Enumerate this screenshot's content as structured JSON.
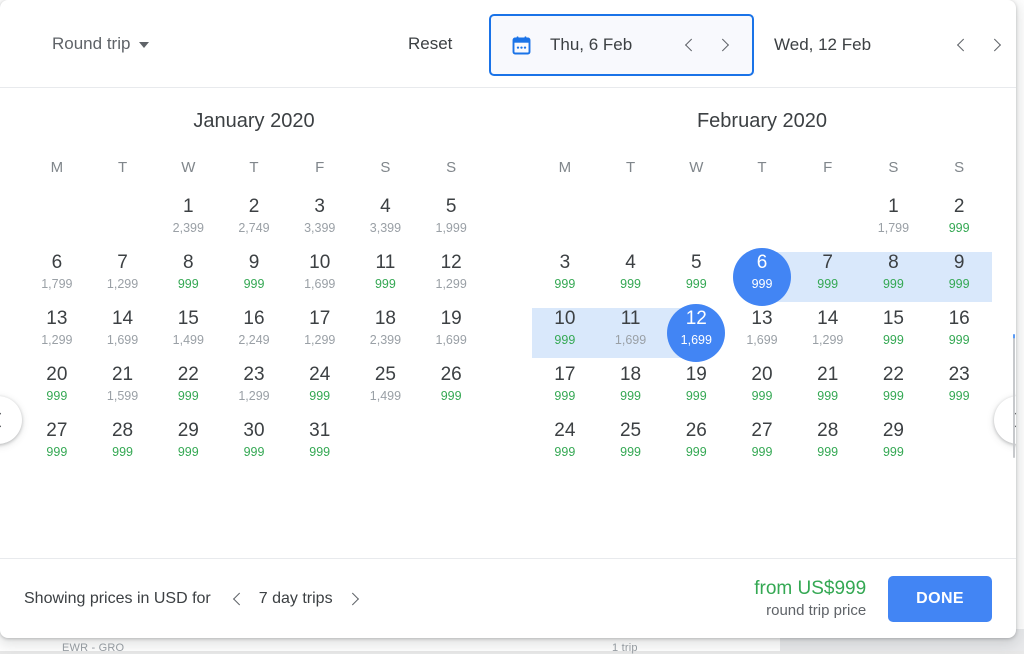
{
  "header": {
    "trip_type_label": "Round trip",
    "trip_type_icon": "chevron-down-icon",
    "reset_label": "Reset",
    "depart": {
      "icon": "calendar-icon",
      "value": "Thu, 6 Feb",
      "prev_icon": "chevron-left-icon",
      "next_icon": "chevron-right-icon"
    },
    "return": {
      "value": "Wed, 12 Feb",
      "prev_icon": "chevron-left-icon",
      "next_icon": "chevron-right-icon"
    }
  },
  "calendar": {
    "prev_month_icon": "chevron-left-icon",
    "next_month_icon": "chevron-right-icon",
    "dow": [
      "M",
      "T",
      "W",
      "T",
      "F",
      "S",
      "S"
    ],
    "months": [
      {
        "title": "January 2020",
        "weeks": [
          [
            {
              "day": "",
              "price": ""
            },
            {
              "day": "",
              "price": ""
            },
            {
              "day": "1",
              "price": "2,399",
              "cheap": false
            },
            {
              "day": "2",
              "price": "2,749",
              "cheap": false
            },
            {
              "day": "3",
              "price": "3,399",
              "cheap": false
            },
            {
              "day": "4",
              "price": "3,399",
              "cheap": false
            },
            {
              "day": "5",
              "price": "1,999",
              "cheap": false
            }
          ],
          [
            {
              "day": "6",
              "price": "1,799",
              "cheap": false
            },
            {
              "day": "7",
              "price": "1,299",
              "cheap": false
            },
            {
              "day": "8",
              "price": "999",
              "cheap": true
            },
            {
              "day": "9",
              "price": "999",
              "cheap": true
            },
            {
              "day": "10",
              "price": "1,699",
              "cheap": false
            },
            {
              "day": "11",
              "price": "999",
              "cheap": true
            },
            {
              "day": "12",
              "price": "1,299",
              "cheap": false
            }
          ],
          [
            {
              "day": "13",
              "price": "1,299",
              "cheap": false
            },
            {
              "day": "14",
              "price": "1,699",
              "cheap": false
            },
            {
              "day": "15",
              "price": "1,499",
              "cheap": false
            },
            {
              "day": "16",
              "price": "2,249",
              "cheap": false
            },
            {
              "day": "17",
              "price": "1,299",
              "cheap": false
            },
            {
              "day": "18",
              "price": "2,399",
              "cheap": false
            },
            {
              "day": "19",
              "price": "1,699",
              "cheap": false
            }
          ],
          [
            {
              "day": "20",
              "price": "999",
              "cheap": true
            },
            {
              "day": "21",
              "price": "1,599",
              "cheap": false
            },
            {
              "day": "22",
              "price": "999",
              "cheap": true
            },
            {
              "day": "23",
              "price": "1,299",
              "cheap": false
            },
            {
              "day": "24",
              "price": "999",
              "cheap": true
            },
            {
              "day": "25",
              "price": "1,499",
              "cheap": false
            },
            {
              "day": "26",
              "price": "999",
              "cheap": true
            }
          ],
          [
            {
              "day": "27",
              "price": "999",
              "cheap": true
            },
            {
              "day": "28",
              "price": "999",
              "cheap": true
            },
            {
              "day": "29",
              "price": "999",
              "cheap": true
            },
            {
              "day": "30",
              "price": "999",
              "cheap": true
            },
            {
              "day": "31",
              "price": "999",
              "cheap": true
            },
            {
              "day": "",
              "price": ""
            },
            {
              "day": "",
              "price": ""
            }
          ]
        ]
      },
      {
        "title": "February 2020",
        "weeks": [
          [
            {
              "day": "",
              "price": ""
            },
            {
              "day": "",
              "price": ""
            },
            {
              "day": "",
              "price": ""
            },
            {
              "day": "",
              "price": ""
            },
            {
              "day": "",
              "price": ""
            },
            {
              "day": "1",
              "price": "1,799",
              "cheap": false
            },
            {
              "day": "2",
              "price": "999",
              "cheap": true
            }
          ],
          [
            {
              "day": "3",
              "price": "999",
              "cheap": true
            },
            {
              "day": "4",
              "price": "999",
              "cheap": true
            },
            {
              "day": "5",
              "price": "999",
              "cheap": true
            },
            {
              "day": "6",
              "price": "999",
              "cheap": true,
              "selected": true
            },
            {
              "day": "7",
              "price": "999",
              "cheap": true,
              "inrange": true
            },
            {
              "day": "8",
              "price": "999",
              "cheap": true,
              "inrange": true
            },
            {
              "day": "9",
              "price": "999",
              "cheap": true,
              "inrange": true
            }
          ],
          [
            {
              "day": "10",
              "price": "999",
              "cheap": true,
              "inrange": true
            },
            {
              "day": "11",
              "price": "1,699",
              "cheap": false,
              "inrange": true
            },
            {
              "day": "12",
              "price": "1,699",
              "cheap": false,
              "selected": true
            },
            {
              "day": "13",
              "price": "1,699",
              "cheap": false
            },
            {
              "day": "14",
              "price": "1,299",
              "cheap": false
            },
            {
              "day": "15",
              "price": "999",
              "cheap": true
            },
            {
              "day": "16",
              "price": "999",
              "cheap": true
            }
          ],
          [
            {
              "day": "17",
              "price": "999",
              "cheap": true
            },
            {
              "day": "18",
              "price": "999",
              "cheap": true
            },
            {
              "day": "19",
              "price": "999",
              "cheap": true
            },
            {
              "day": "20",
              "price": "999",
              "cheap": true
            },
            {
              "day": "21",
              "price": "999",
              "cheap": true
            },
            {
              "day": "22",
              "price": "999",
              "cheap": true
            },
            {
              "day": "23",
              "price": "999",
              "cheap": true
            }
          ],
          [
            {
              "day": "24",
              "price": "999",
              "cheap": true
            },
            {
              "day": "25",
              "price": "999",
              "cheap": true
            },
            {
              "day": "26",
              "price": "999",
              "cheap": true
            },
            {
              "day": "27",
              "price": "999",
              "cheap": true
            },
            {
              "day": "28",
              "price": "999",
              "cheap": true
            },
            {
              "day": "29",
              "price": "999",
              "cheap": true
            },
            {
              "day": "",
              "price": ""
            }
          ]
        ]
      }
    ]
  },
  "footer": {
    "showing_label": "Showing prices in USD for",
    "trip_length": "7 day trips",
    "prev_icon": "chevron-left-icon",
    "next_icon": "chevron-right-icon",
    "price_main": "from US$999",
    "price_sub": "round trip price",
    "done_label": "DONE"
  },
  "background": {
    "left_text": "EWR - GRO",
    "mid_text": "1 trip"
  },
  "colors": {
    "accent_blue": "#4285f4",
    "focus_blue": "#1a73e8",
    "range_blue": "#d9e8fb",
    "cheap_green": "#34a853",
    "text_primary": "#3c4043",
    "text_secondary": "#5f6368",
    "text_muted": "#9aa0a6"
  }
}
